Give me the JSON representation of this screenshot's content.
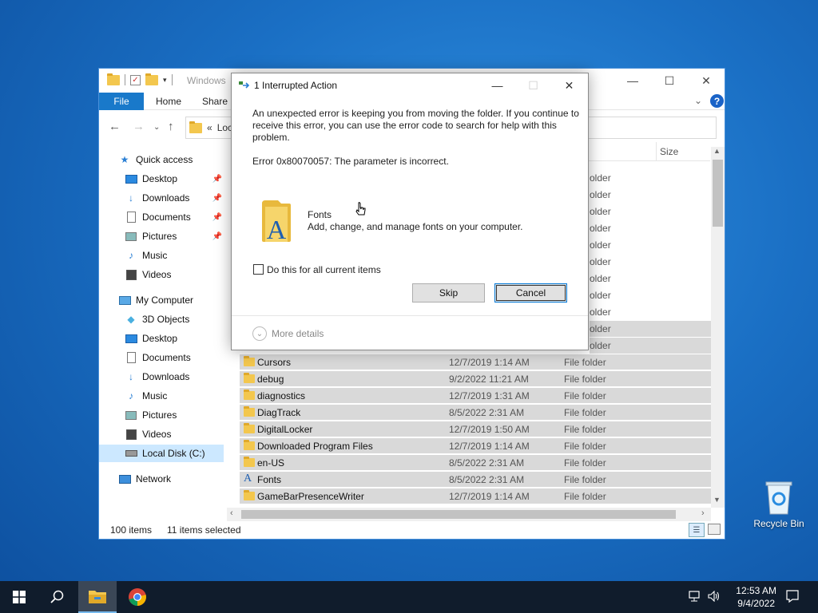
{
  "explorer": {
    "title": "Windows",
    "ribbon_tabs": {
      "file": "File",
      "home": "Home",
      "share": "Share"
    },
    "address": {
      "prefix": "«",
      "text": "Loc"
    },
    "column_size": "Size",
    "nav": {
      "quick_access": "Quick access",
      "qa_desktop": "Desktop",
      "qa_downloads": "Downloads",
      "qa_documents": "Documents",
      "qa_pictures": "Pictures",
      "qa_music": "Music",
      "qa_videos": "Videos",
      "my_computer": "My Computer",
      "mc_3d": "3D Objects",
      "mc_desktop": "Desktop",
      "mc_documents": "Documents",
      "mc_downloads": "Downloads",
      "mc_music": "Music",
      "mc_pictures": "Pictures",
      "mc_videos": "Videos",
      "local_disk": "Local Disk (C:)",
      "network": "Network"
    },
    "partial_type": "older",
    "files": [
      {
        "name": "Cursors",
        "date": "12/7/2019 1:14 AM",
        "type": "File folder"
      },
      {
        "name": "debug",
        "date": "9/2/2022 11:21 AM",
        "type": "File folder"
      },
      {
        "name": "diagnostics",
        "date": "12/7/2019 1:31 AM",
        "type": "File folder"
      },
      {
        "name": "DiagTrack",
        "date": "8/5/2022 2:31 AM",
        "type": "File folder"
      },
      {
        "name": "DigitalLocker",
        "date": "12/7/2019 1:50 AM",
        "type": "File folder"
      },
      {
        "name": "Downloaded Program Files",
        "date": "12/7/2019 1:14 AM",
        "type": "File folder"
      },
      {
        "name": "en-US",
        "date": "8/5/2022 2:31 AM",
        "type": "File folder"
      },
      {
        "name": "Fonts",
        "date": "8/5/2022 2:31 AM",
        "type": "File folder"
      },
      {
        "name": "GameBarPresenceWriter",
        "date": "12/7/2019 1:14 AM",
        "type": "File folder"
      }
    ],
    "status": {
      "items": "100 items",
      "selected": "11 items selected"
    }
  },
  "dialog": {
    "title": "1 Interrupted Action",
    "message": "An unexpected error is keeping you from moving the folder. If you continue to receive this error, you can use the error code to search for help with this problem.",
    "error": "Error 0x80070057: The parameter is incorrect.",
    "item_name": "Fonts",
    "item_desc": "Add, change, and manage fonts on your computer.",
    "checkbox_label": "Do this for all current items",
    "checkbox_checked": false,
    "skip_label": "Skip",
    "cancel_label": "Cancel",
    "more_details": "More details"
  },
  "desktop": {
    "recycle_bin": "Recycle Bin"
  },
  "taskbar": {
    "time": "12:53 AM",
    "date": "9/4/2022"
  },
  "colors": {
    "accent": "#1979ca",
    "selection": "#d9d9d9",
    "taskbar": "#101c2c"
  }
}
